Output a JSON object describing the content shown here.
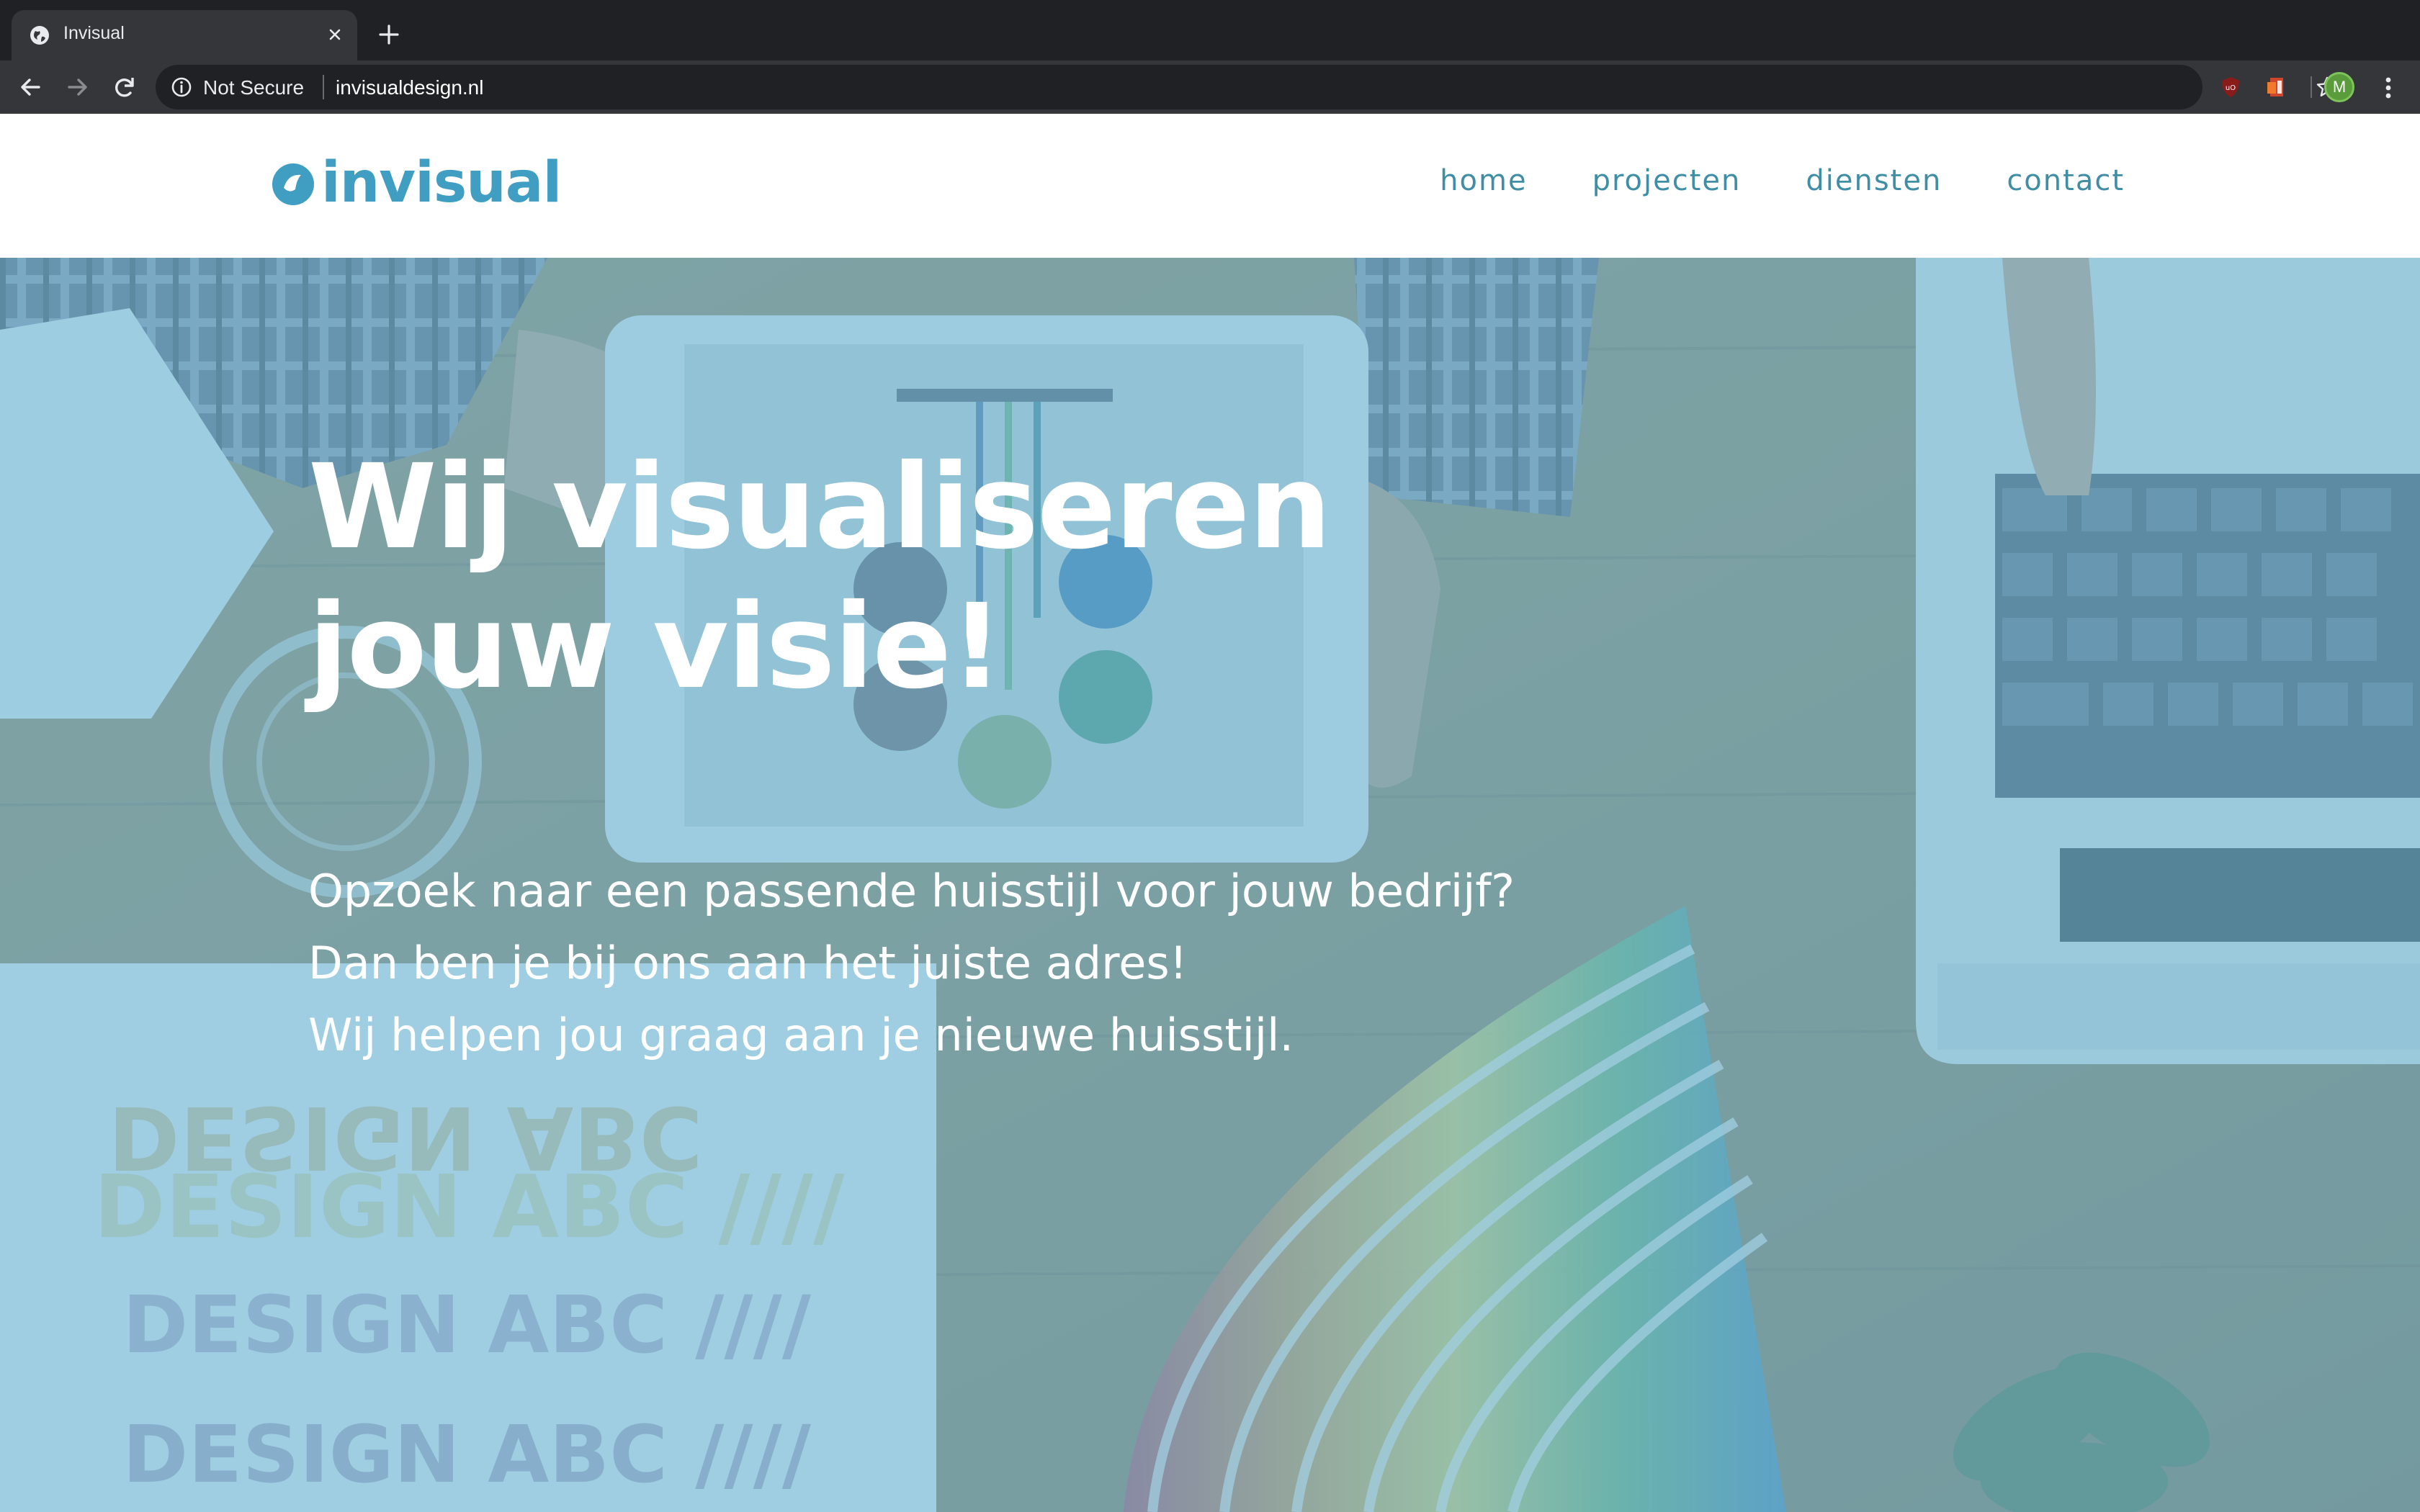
{
  "browser": {
    "tab_title": "Invisual",
    "security_label": "Not Secure",
    "url": "invisualdesign.nl",
    "profile_initial": "M"
  },
  "site": {
    "logo_text": "invisual",
    "nav": [
      "home",
      "projecten",
      "diensten",
      "contact"
    ]
  },
  "hero": {
    "title_line_1": "Wij visualiseren",
    "title_line_2": "jouw visie!",
    "lines": [
      "Opzoek naar een passende huisstijl voor jouw bedrijf?",
      "Dan ben je bij ons aan het juiste adres!",
      "Wij helpen jou graag aan je nieuwe huisstijl."
    ]
  },
  "colors": {
    "brand": "#3f9ec2",
    "nav_text": "#3f8ea6",
    "hero_overlay": "#6fb8d6",
    "chrome_dark": "#202124",
    "chrome_toolbar": "#35363a"
  }
}
